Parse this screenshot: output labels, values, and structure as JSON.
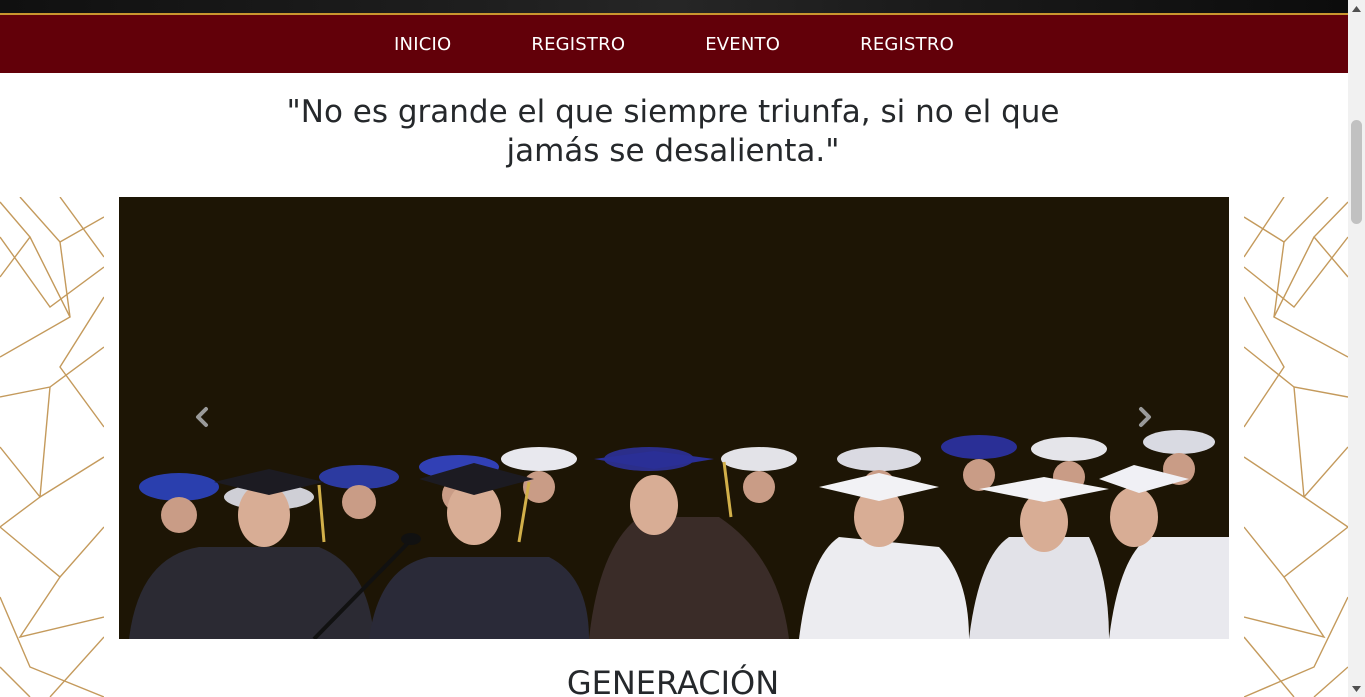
{
  "nav": {
    "items": [
      {
        "label": "INICIO"
      },
      {
        "label": "REGISTRO"
      },
      {
        "label": "EVENTO"
      },
      {
        "label": "REGISTRO"
      }
    ]
  },
  "quote": {
    "text": "\"No es grande el que siempre triunfa, si no el que jamás se desalienta.\""
  },
  "carousel": {
    "image_description_icon": "graduates-photo",
    "prev_icon": "chevron-left-icon",
    "next_icon": "chevron-right-icon"
  },
  "section": {
    "title": "GENERACIÓN"
  },
  "colors": {
    "navbar_bg": "#620009",
    "navbar_border": "#c9962f",
    "pattern_gold": "#c49a5c",
    "text_dark": "#25282b"
  }
}
